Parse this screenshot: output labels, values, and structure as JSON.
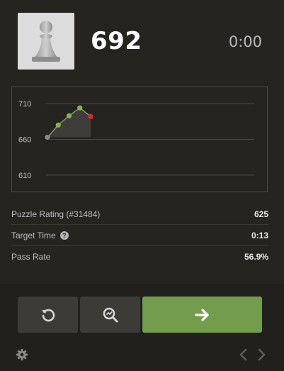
{
  "header": {
    "rating": "692",
    "timer": "0:00",
    "avatar_icon": "pawn-icon"
  },
  "chart_data": {
    "type": "line",
    "x": [
      0,
      1,
      2,
      3,
      4
    ],
    "values": [
      663,
      680,
      693,
      704,
      692
    ],
    "point_colors": [
      "#8a8a8a",
      "#81b64c",
      "#81b64c",
      "#81b64c",
      "#e02828"
    ],
    "ytick_labels": [
      "710",
      "660",
      "610"
    ],
    "ylim": [
      597,
      723
    ],
    "grid": true
  },
  "stats": [
    {
      "label": "Puzzle Rating (#31484)",
      "value": "625",
      "help": false
    },
    {
      "label": "Target Time",
      "value": "0:13",
      "help": true
    },
    {
      "label": "Pass Rate",
      "value": "56.9%",
      "help": false
    }
  ],
  "footer": {
    "retry_icon": "retry-icon",
    "analysis_icon": "analysis-icon",
    "next_icon": "arrow-right-icon",
    "settings_icon": "gear-icon",
    "prev_icon": "chevron-left-icon",
    "next_nav_icon": "chevron-right-icon"
  },
  "colors": {
    "accent_green": "#739c4c",
    "fail_red": "#e02828",
    "pass_green": "#81b64c",
    "background": "#262421"
  }
}
